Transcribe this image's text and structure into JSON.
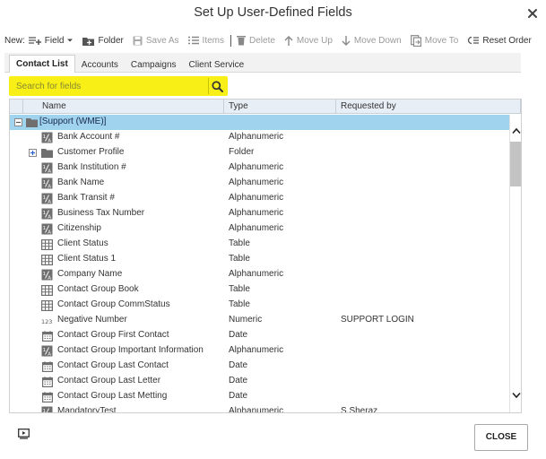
{
  "dialog": {
    "title": "Set Up User-Defined Fields"
  },
  "toolbar": {
    "new_label": "New:",
    "field_label": "Field",
    "folder_label": "Folder",
    "save_as_label": "Save As",
    "items_label": "Items",
    "delete_label": "Delete",
    "move_up_label": "Move Up",
    "move_down_label": "Move Down",
    "move_to_label": "Move To",
    "reset_order_label": "Reset Order"
  },
  "tabs": [
    {
      "label": "Contact List",
      "active": true
    },
    {
      "label": "Accounts",
      "active": false
    },
    {
      "label": "Campaigns",
      "active": false
    },
    {
      "label": "Client Service",
      "active": false
    }
  ],
  "search": {
    "placeholder": "Search for fields"
  },
  "grid": {
    "columns": [
      "Name",
      "Type",
      "Requested by"
    ],
    "root": {
      "name": "[Support (WME)]"
    },
    "rows": [
      {
        "name": "Bank Account #",
        "type": "Alphanumeric",
        "requested_by": "",
        "icon": "alphanumeric-icon"
      },
      {
        "name": "Customer Profile",
        "type": "Folder",
        "requested_by": "",
        "icon": "folder-icon",
        "expandable": true
      },
      {
        "name": "Bank Institution #",
        "type": "Alphanumeric",
        "requested_by": "",
        "icon": "alphanumeric-icon"
      },
      {
        "name": "Bank Name",
        "type": "Alphanumeric",
        "requested_by": "",
        "icon": "alphanumeric-icon"
      },
      {
        "name": "Bank Transit #",
        "type": "Alphanumeric",
        "requested_by": "",
        "icon": "alphanumeric-icon"
      },
      {
        "name": "Business Tax Number",
        "type": "Alphanumeric",
        "requested_by": "",
        "icon": "alphanumeric-icon"
      },
      {
        "name": "Citizenship",
        "type": "Alphanumeric",
        "requested_by": "",
        "icon": "alphanumeric-icon"
      },
      {
        "name": "Client Status",
        "type": "Table",
        "requested_by": "",
        "icon": "table-icon"
      },
      {
        "name": "Client Status 1",
        "type": "Table",
        "requested_by": "",
        "icon": "table-icon"
      },
      {
        "name": "Company Name",
        "type": "Alphanumeric",
        "requested_by": "",
        "icon": "alphanumeric-icon"
      },
      {
        "name": "Contact Group Book",
        "type": "Table",
        "requested_by": "",
        "icon": "table-icon"
      },
      {
        "name": "Contact Group CommStatus",
        "type": "Table",
        "requested_by": "",
        "icon": "table-icon"
      },
      {
        "name": "Negative Number",
        "type": "Numeric",
        "requested_by": "SUPPORT LOGIN",
        "icon": "numeric-icon"
      },
      {
        "name": "Contact Group First Contact",
        "type": "Date",
        "requested_by": "",
        "icon": "calendar-icon"
      },
      {
        "name": "Contact Group Important Information",
        "type": "Alphanumeric",
        "requested_by": "",
        "icon": "alphanumeric-icon"
      },
      {
        "name": "Contact Group Last Contact",
        "type": "Date",
        "requested_by": "",
        "icon": "calendar-icon"
      },
      {
        "name": "Contact Group Last Letter",
        "type": "Date",
        "requested_by": "",
        "icon": "calendar-icon"
      },
      {
        "name": "Contact Group Last Metting",
        "type": "Date",
        "requested_by": "",
        "icon": "calendar-icon"
      },
      {
        "name": "MandatoryTest",
        "type": "Alphanumeric",
        "requested_by": "S.Sheraz",
        "icon": "alphanumeric-icon"
      }
    ]
  },
  "footer": {
    "close_label": "CLOSE"
  },
  "colors": {
    "search_highlight": "#f7ef16",
    "selected_row": "#9fd3ee",
    "header_bg": "#e8eef5"
  }
}
